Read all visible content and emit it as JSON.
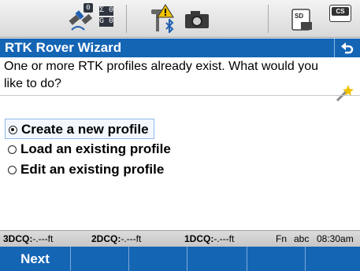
{
  "status_bar": {
    "satellites": {
      "gps_label": "Σ 0",
      "glonass_label": "G 0",
      "badge": "0"
    },
    "icons": [
      "satellite-icon",
      "antenna-warning-icon",
      "bluetooth-icon",
      "camera-icon",
      "sd-card-icon",
      "cs-icon"
    ],
    "cs_label": "CS",
    "sd_label": "SD"
  },
  "title_bar": {
    "title": "RTK Rover Wizard",
    "back_glyph": "↰"
  },
  "prompt": "One or more RTK profiles already exist.  What would you like to do?",
  "options": [
    {
      "label": "Create a new profile",
      "selected": true
    },
    {
      "label": "Load an existing profile",
      "selected": false
    },
    {
      "label": "Edit an existing profile",
      "selected": false
    }
  ],
  "info_strip": {
    "d3_label": "3DCQ:",
    "d3_value": "-.---ft",
    "d2_label": "2DCQ:",
    "d2_value": "-.---ft",
    "d1_label": "1DCQ:",
    "d1_value": "-.---ft",
    "fn": "Fn",
    "mode": "abc",
    "time": "08:30am"
  },
  "softkeys": [
    "Next",
    "",
    "",
    "",
    "",
    ""
  ]
}
